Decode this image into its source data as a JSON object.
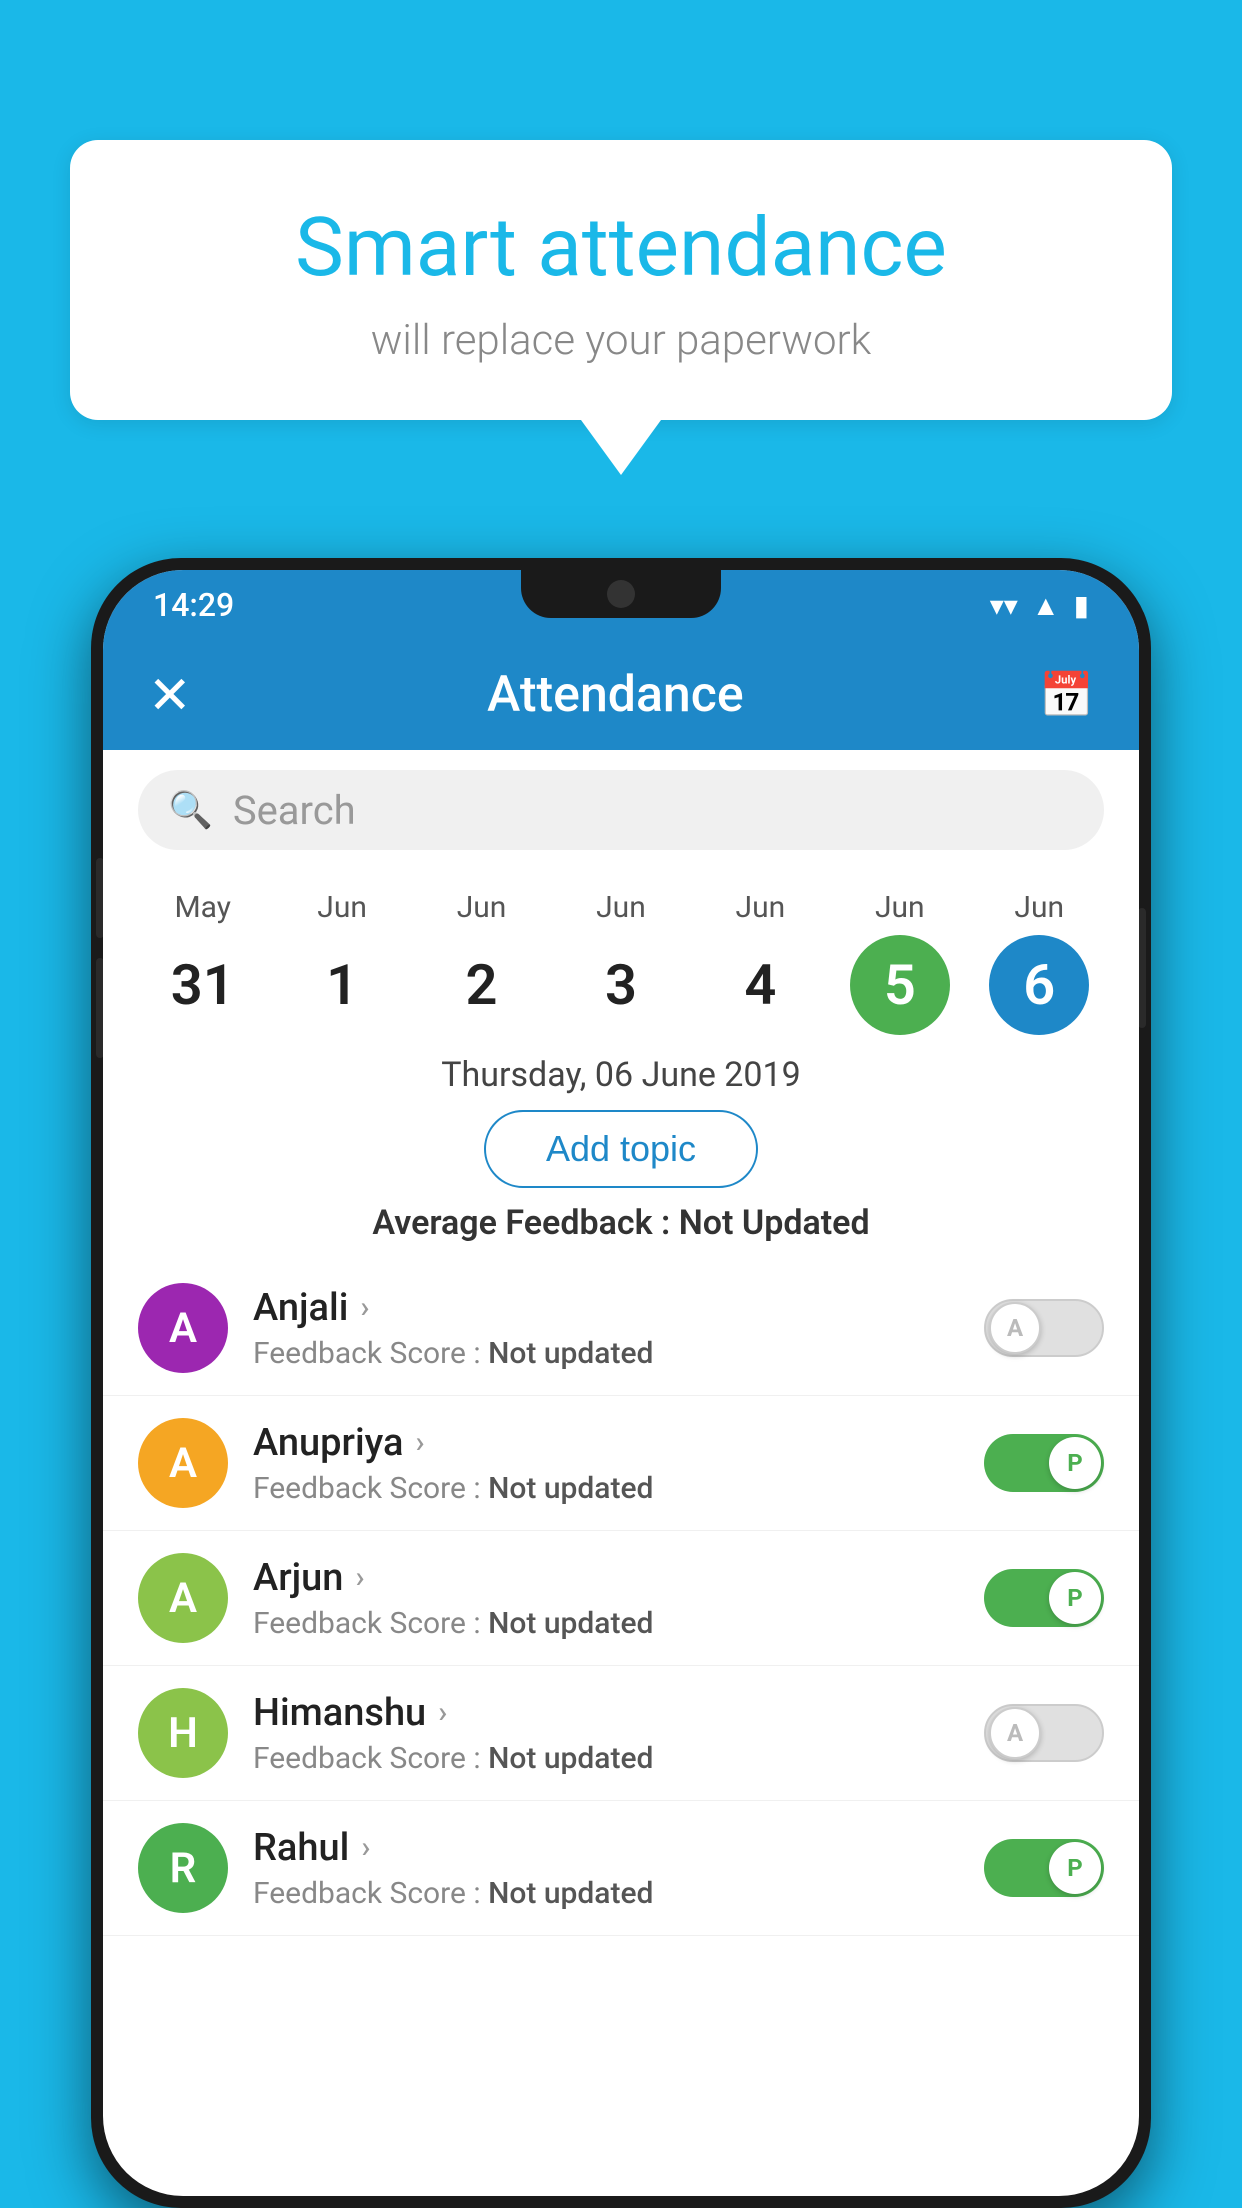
{
  "background_color": "#1ab8e8",
  "speech_bubble": {
    "title": "Smart attendance",
    "subtitle": "will replace your paperwork"
  },
  "status_bar": {
    "time": "14:29",
    "icons": [
      "wifi",
      "signal",
      "battery"
    ]
  },
  "header": {
    "title": "Attendance",
    "close_label": "✕",
    "calendar_icon": "📅"
  },
  "search": {
    "placeholder": "Search"
  },
  "calendar": {
    "days": [
      {
        "month": "May",
        "num": "31",
        "state": "normal"
      },
      {
        "month": "Jun",
        "num": "1",
        "state": "normal"
      },
      {
        "month": "Jun",
        "num": "2",
        "state": "normal"
      },
      {
        "month": "Jun",
        "num": "3",
        "state": "normal"
      },
      {
        "month": "Jun",
        "num": "4",
        "state": "normal"
      },
      {
        "month": "Jun",
        "num": "5",
        "state": "today"
      },
      {
        "month": "Jun",
        "num": "6",
        "state": "selected"
      }
    ]
  },
  "selected_date": "Thursday, 06 June 2019",
  "add_topic_label": "Add topic",
  "avg_feedback_label": "Average Feedback : ",
  "avg_feedback_value": "Not Updated",
  "students": [
    {
      "name": "Anjali",
      "avatar_letter": "A",
      "avatar_color": "#9c27b0",
      "feedback_label": "Feedback Score : ",
      "feedback_value": "Not updated",
      "attendance": "absent",
      "toggle_letter": "A"
    },
    {
      "name": "Anupriya",
      "avatar_letter": "A",
      "avatar_color": "#f5a623",
      "feedback_label": "Feedback Score : ",
      "feedback_value": "Not updated",
      "attendance": "present",
      "toggle_letter": "P"
    },
    {
      "name": "Arjun",
      "avatar_letter": "A",
      "avatar_color": "#8bc34a",
      "feedback_label": "Feedback Score : ",
      "feedback_value": "Not updated",
      "attendance": "present",
      "toggle_letter": "P"
    },
    {
      "name": "Himanshu",
      "avatar_letter": "H",
      "avatar_color": "#8bc34a",
      "feedback_label": "Feedback Score : ",
      "feedback_value": "Not updated",
      "attendance": "absent",
      "toggle_letter": "A"
    },
    {
      "name": "Rahul",
      "avatar_letter": "R",
      "avatar_color": "#4caf50",
      "feedback_label": "Feedback Score : ",
      "feedback_value": "Not updated",
      "attendance": "present",
      "toggle_letter": "P"
    }
  ]
}
